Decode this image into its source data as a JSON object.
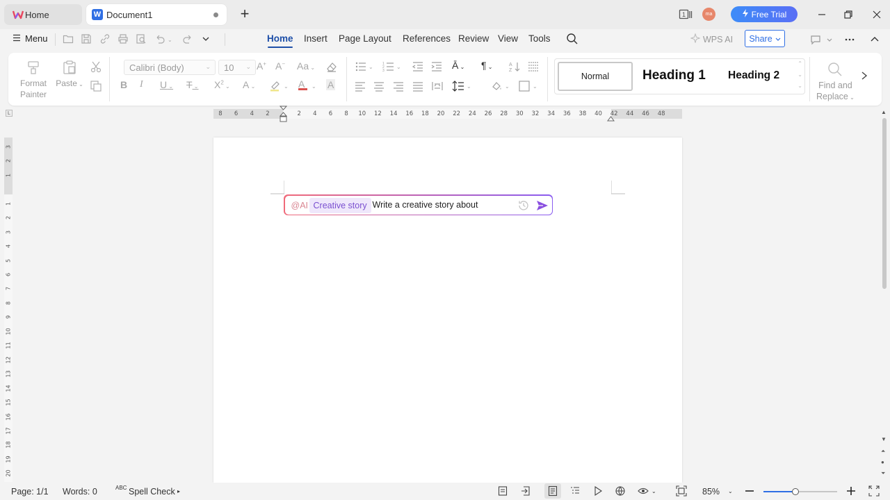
{
  "tabs": {
    "home_label": "Home",
    "doc_label": "Document1",
    "new_tab_glyph": "+"
  },
  "titlebar": {
    "avatar_text": "ma",
    "free_trial_label": "Free Trial"
  },
  "menubar": {
    "menu_label": "Menu",
    "tabs": [
      "Home",
      "Insert",
      "Page Layout",
      "References",
      "Review",
      "View",
      "Tools"
    ],
    "wps_ai_label": "WPS AI",
    "share_label": "Share"
  },
  "ribbon": {
    "format_painter_line1": "Format",
    "format_painter_line2": "Painter",
    "paste_label": "Paste",
    "font_name": "Calibri (Body)",
    "font_size": "10",
    "styles": {
      "normal": "Normal",
      "heading1": "Heading 1",
      "heading2": "Heading 2"
    },
    "find_line1": "Find and",
    "find_line2": "Replace"
  },
  "rulers": {
    "tab_marker": "L",
    "horizontal": [
      "8",
      "6",
      "4",
      "2",
      "2",
      "4",
      "6",
      "8",
      "10",
      "12",
      "14",
      "16",
      "18",
      "20",
      "22",
      "24",
      "26",
      "28",
      "30",
      "32",
      "34",
      "36",
      "38",
      "40",
      "42",
      "44",
      "46",
      "48"
    ],
    "vertical": [
      "3",
      "2",
      "1",
      "1",
      "2",
      "3",
      "4",
      "5",
      "6",
      "7",
      "8",
      "9",
      "10",
      "11",
      "12",
      "13",
      "14",
      "15",
      "16",
      "17",
      "18",
      "19",
      "20"
    ]
  },
  "ai_prompt": {
    "prefix": "@AI",
    "chip": "Creative story",
    "text": "Write a creative story about"
  },
  "statusbar": {
    "page": "Page: 1/1",
    "words": "Words: 0",
    "spell_badge": "ABC",
    "spell_check": "Spell Check",
    "zoom_percent": "85%",
    "zoom_level": 0.43
  },
  "colors": {
    "accent": "#1e4fa8",
    "share_blue": "#2f6fe4",
    "ai_gradient_start": "#f06a7a",
    "ai_gradient_end": "#8a5cf0",
    "chip_text": "#7a4fd0"
  },
  "icons": [
    "wps-logo-icon",
    "word-doc-icon",
    "reading-mode-icon",
    "new-file-icon",
    "open-folder-icon",
    "save-icon",
    "link-icon",
    "print-icon",
    "print-preview-icon",
    "undo-icon",
    "redo-icon",
    "search-icon",
    "wps-ai-icon",
    "comment-icon",
    "more-icon",
    "collapse-ribbon-icon",
    "paste-icon",
    "cut-icon",
    "copy-icon",
    "clear-format-icon",
    "bullets-icon",
    "numbering-icon",
    "find-icon",
    "history-icon",
    "send-icon"
  ]
}
